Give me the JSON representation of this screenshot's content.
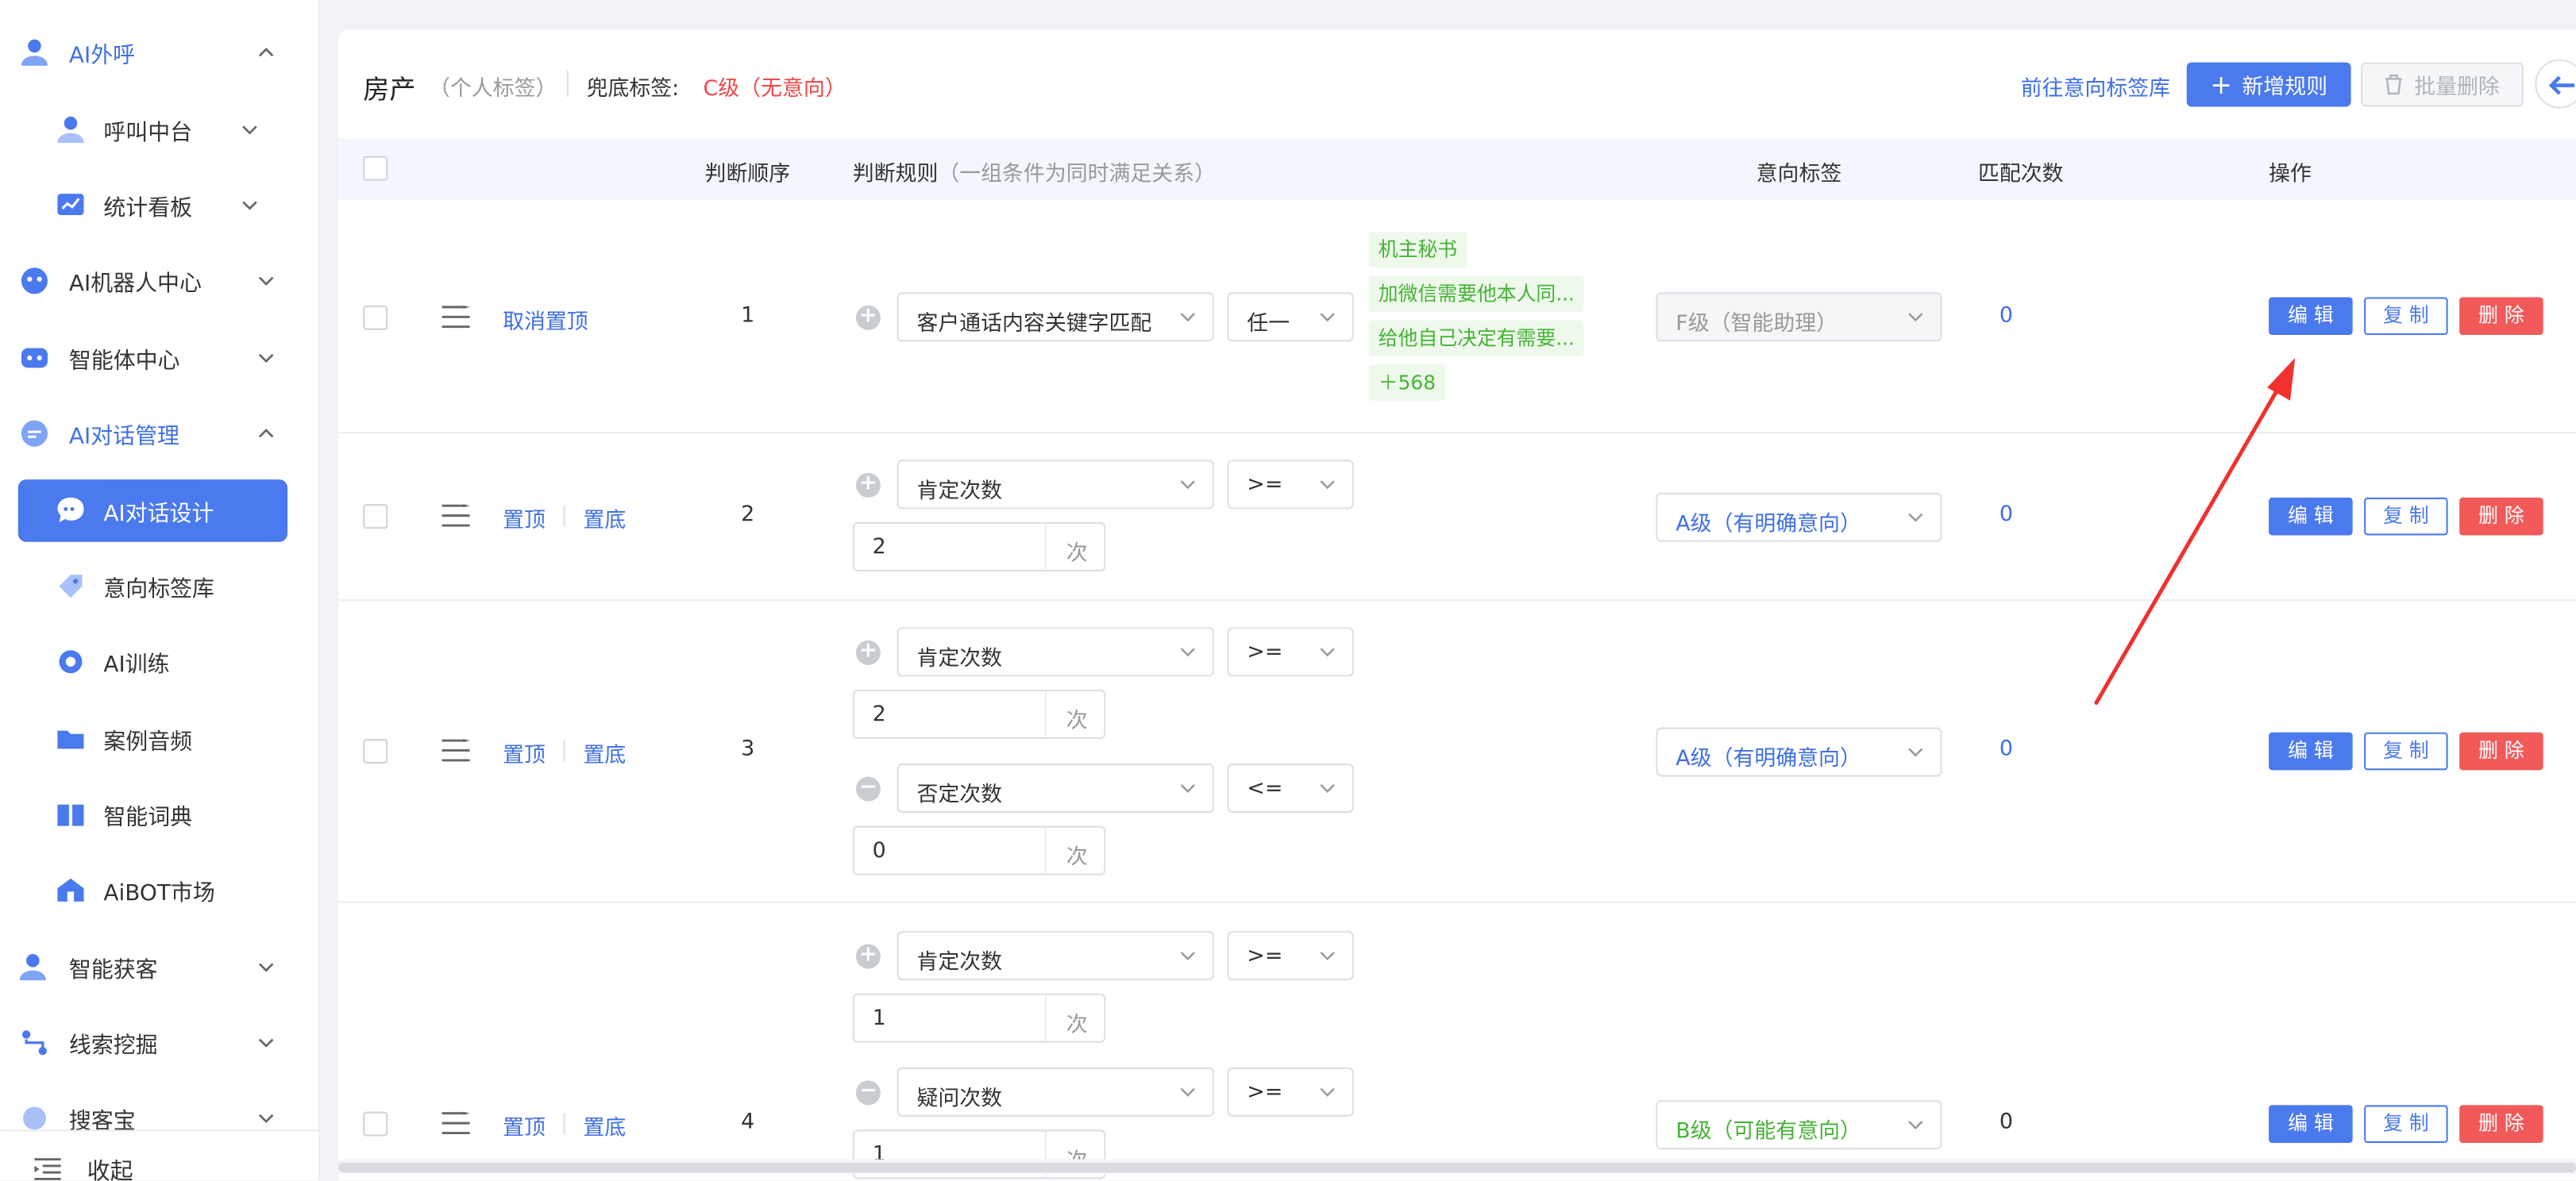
{
  "sidebar": {
    "items": [
      {
        "label": "AI外呼"
      },
      {
        "label": "呼叫中台"
      },
      {
        "label": "统计看板"
      },
      {
        "label": "AI机器人中心"
      },
      {
        "label": "智能体中心"
      },
      {
        "label": "AI对话管理"
      },
      {
        "label": "AI对话设计"
      },
      {
        "label": "意向标签库"
      },
      {
        "label": "AI训练"
      },
      {
        "label": "案例音频"
      },
      {
        "label": "智能词典"
      },
      {
        "label": "AiBOT市场"
      },
      {
        "label": "智能获客"
      },
      {
        "label": "线索挖掘"
      },
      {
        "label": "搜客宝"
      }
    ],
    "collapse_label": "收起"
  },
  "header": {
    "title": "房产",
    "title_sub": "（个人标签）",
    "fallback_label": "兜底标签:",
    "fallback_value": "C级（无意向）",
    "goto_link": "前往意向标签库",
    "add_button": "新增规则",
    "batch_delete": "批量删除"
  },
  "table": {
    "columns": {
      "order": "判断顺序",
      "rule": "判断规则",
      "rule_sub": "（一组条件为同时满足关系）",
      "intent": "意向标签",
      "count": "匹配次数",
      "ops": "操作"
    },
    "actions": {
      "edit": "编 辑",
      "copy": "复 制",
      "delete": "删 除"
    },
    "unit": "次",
    "rows": [
      {
        "links": [
          "取消置顶"
        ],
        "order": "1",
        "conditions": [
          {
            "field": "客户通话内容关键字匹配",
            "op": "任一"
          }
        ],
        "tags": [
          "机主秘书",
          "加微信需要他本人同...",
          "给他自己决定有需要...",
          "＋568"
        ],
        "intent": "F级（智能助理）",
        "count": "0"
      },
      {
        "links": [
          "置顶",
          "置底"
        ],
        "order": "2",
        "conditions": [
          {
            "field": "肯定次数",
            "op": ">=",
            "value": "2"
          }
        ],
        "intent": "A级（有明确意向）",
        "count": "0"
      },
      {
        "links": [
          "置顶",
          "置底"
        ],
        "order": "3",
        "conditions": [
          {
            "field": "肯定次数",
            "op": ">=",
            "value": "2"
          },
          {
            "field": "否定次数",
            "op": "<=",
            "value": "0"
          }
        ],
        "intent": "A级（有明确意向）",
        "count": "0"
      },
      {
        "links": [
          "置顶",
          "置底"
        ],
        "order": "4",
        "conditions": [
          {
            "field": "肯定次数",
            "op": ">=",
            "value": "1"
          },
          {
            "field": "疑问次数",
            "op": ">=",
            "value": "1"
          }
        ],
        "intent": "B级（可能有意向）",
        "count": "0"
      }
    ]
  },
  "colors": {
    "primary": "#4b79ee",
    "danger": "#f25a5a",
    "red_text": "#f24646",
    "green_tag": "#45b335",
    "annotation_arrow": "#f0312e"
  }
}
